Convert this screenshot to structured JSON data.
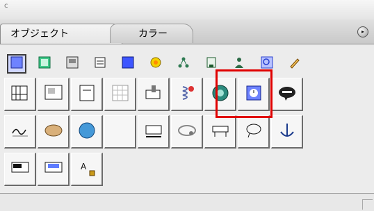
{
  "window": {
    "title_glyph": "ⅽ"
  },
  "tabs": [
    {
      "label": "オブジェクト",
      "active": true
    },
    {
      "label": "カラー",
      "active": false
    }
  ],
  "menu_button_glyph": "▸",
  "tools": [
    "selection-tool-icon",
    "frame-tool-icon",
    "image-tool-icon",
    "list-tool-icon",
    "box-tool-icon",
    "color-wheel-tool-icon",
    "network-tool-icon",
    "document-tool-icon",
    "person-tool-icon",
    "search-tool-icon",
    "pencil-tool-icon"
  ],
  "objects": [
    "grid-object-icon",
    "picture-frame-object-icon",
    "text-frame-object-icon",
    "table-object-icon",
    "stamp-object-icon",
    "spring-object-icon",
    "globe-refresh-object-icon",
    "clock-object-icon",
    "speech-bubble-object-icon",
    "signature-object-icon",
    "oval-object-icon",
    "sphere-object-icon",
    "bracket-object-icon",
    "tray-object-icon",
    "ring-object-icon",
    "bench-object-icon",
    "loop-object-icon",
    "anchor-object-icon",
    "numeric-field-object-icon",
    "stepper-object-icon",
    "text-lock-object-icon"
  ],
  "tab_glyphs": {
    "objects_divider": "｜",
    "color_divider": ""
  }
}
